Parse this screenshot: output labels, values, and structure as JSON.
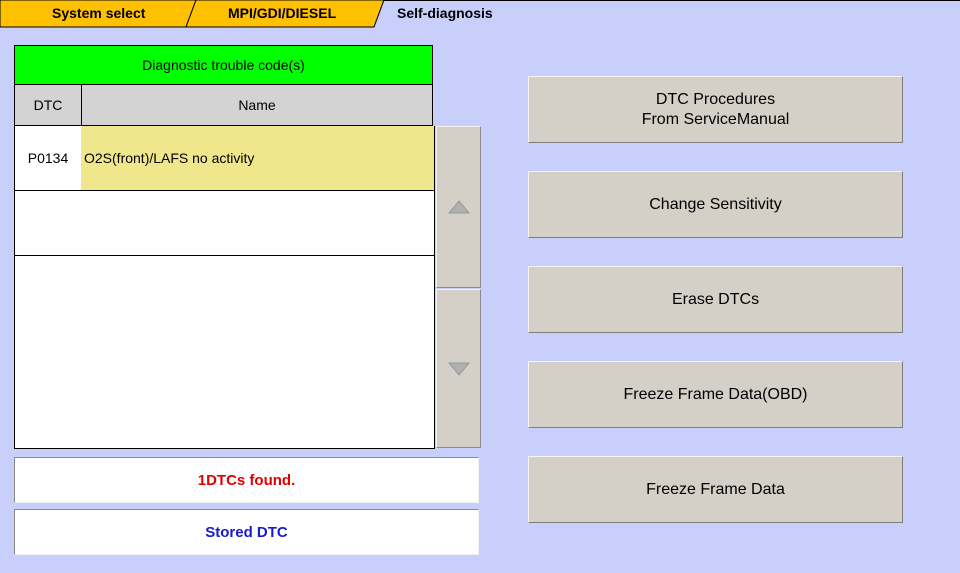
{
  "breadcrumb": {
    "items": [
      {
        "label": "System select"
      },
      {
        "label": "MPI/GDI/DIESEL"
      },
      {
        "label": "Self-diagnosis"
      }
    ],
    "colors": {
      "tab_fill": "#ffc000",
      "current_bg": "#c9cffb"
    }
  },
  "dtc_table": {
    "title": "Diagnostic trouble code(s)",
    "columns": [
      "DTC",
      "Name"
    ],
    "rows": [
      {
        "code": "P0134",
        "name": "O2S(front)/LAFS no activity",
        "selected": true
      },
      {
        "code": "",
        "name": "",
        "selected": false
      },
      {
        "code": "",
        "name": "",
        "selected": false
      },
      {
        "code": "",
        "name": "",
        "selected": false
      },
      {
        "code": "",
        "name": "",
        "selected": false
      }
    ],
    "colors": {
      "header": "#00ff00",
      "selected_row": "#f0e68c",
      "column_header": "#d3d3d3"
    }
  },
  "scroll": {
    "up_icon": "triangle-up-icon",
    "down_icon": "triangle-down-icon"
  },
  "status": {
    "count_text": "1DTCs found.",
    "count_color": "#e00000",
    "mode_text": "Stored DTC",
    "mode_color": "#1a1ad0"
  },
  "actions": [
    {
      "label_line1": "DTC Procedures",
      "label_line2": "From ServiceManual"
    },
    {
      "label_line1": "Change Sensitivity",
      "label_line2": ""
    },
    {
      "label_line1": "Erase DTCs",
      "label_line2": ""
    },
    {
      "label_line1": "Freeze Frame Data(OBD)",
      "label_line2": ""
    },
    {
      "label_line1": "Freeze Frame Data",
      "label_line2": ""
    }
  ],
  "theme": {
    "background": "#c9cffb",
    "button_face": "#d4d0c8"
  }
}
